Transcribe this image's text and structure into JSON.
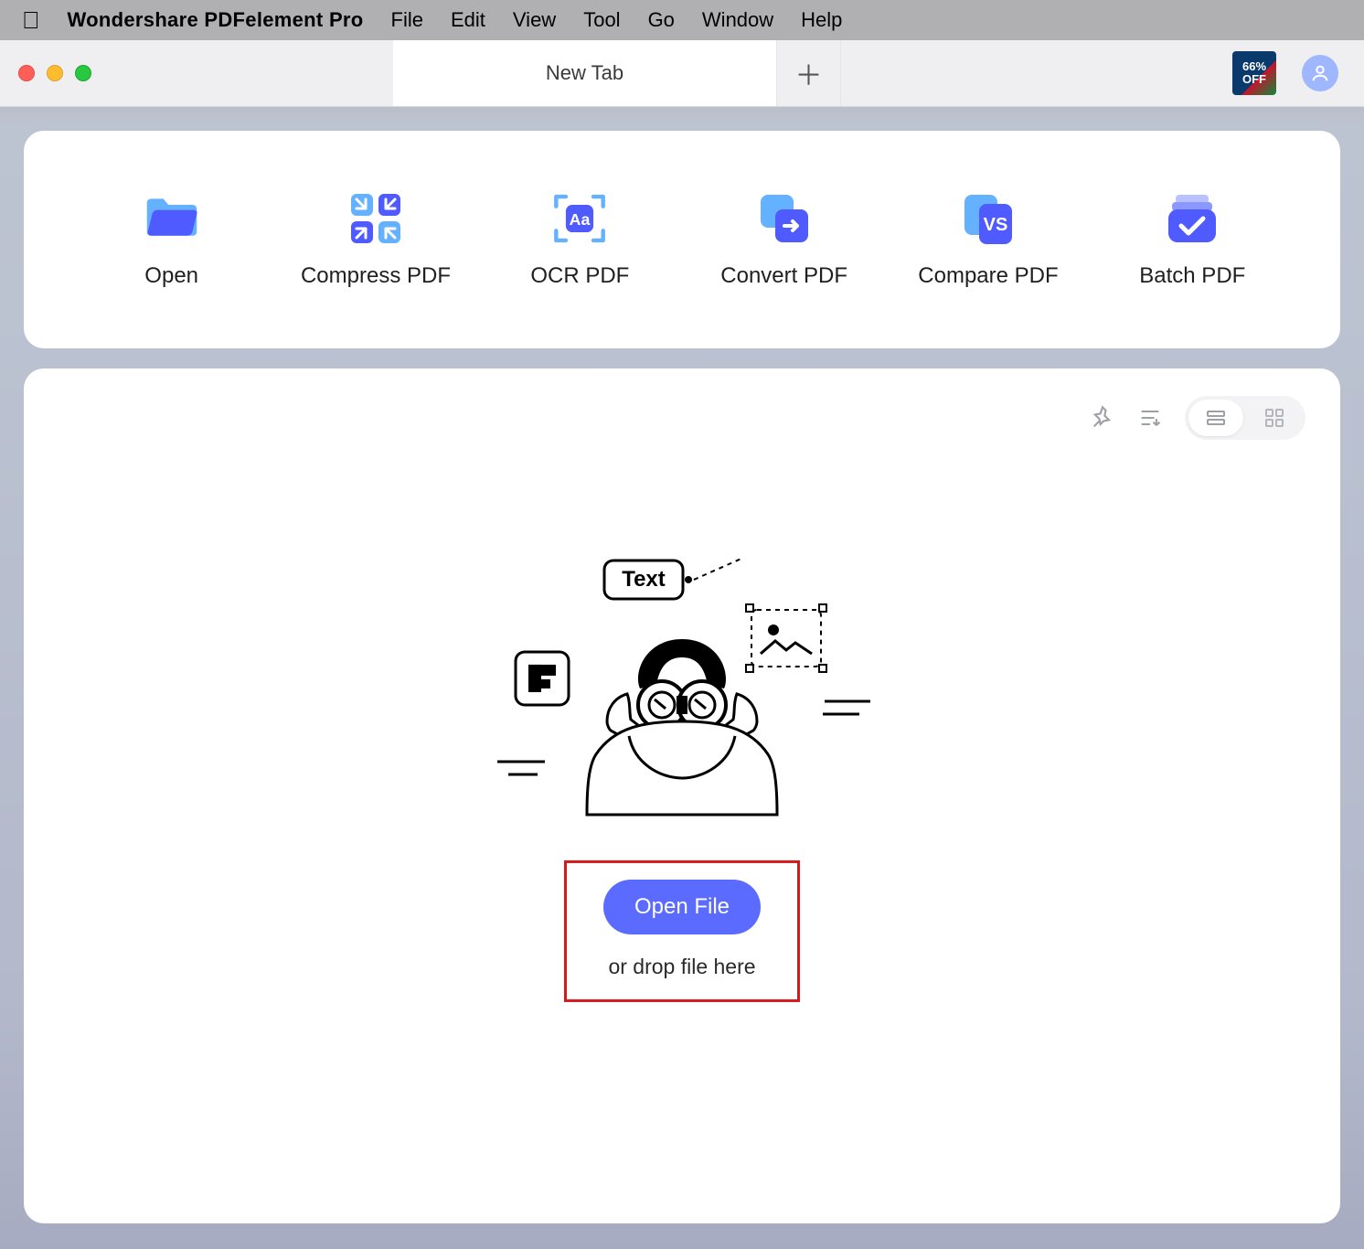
{
  "menubar": {
    "app_name": "Wondershare PDFelement Pro",
    "items": [
      "File",
      "Edit",
      "View",
      "Tool",
      "Go",
      "Window",
      "Help"
    ]
  },
  "tabbar": {
    "tab_label": "New Tab",
    "promo_text": "66% OFF"
  },
  "actions": [
    {
      "id": "open",
      "label": "Open"
    },
    {
      "id": "compress",
      "label": "Compress PDF"
    },
    {
      "id": "ocr",
      "label": "OCR PDF"
    },
    {
      "id": "convert",
      "label": "Convert PDF"
    },
    {
      "id": "compare",
      "label": "Compare PDF"
    },
    {
      "id": "batch",
      "label": "Batch PDF"
    }
  ],
  "empty_state": {
    "bubble_text": "Text",
    "open_button": "Open File",
    "drop_text": "or drop file here"
  },
  "colors": {
    "accent": "#5b6bff",
    "highlight_box": "#d41a1a",
    "icon_light": "#64b2ff",
    "icon_main": "#4f5bff"
  }
}
